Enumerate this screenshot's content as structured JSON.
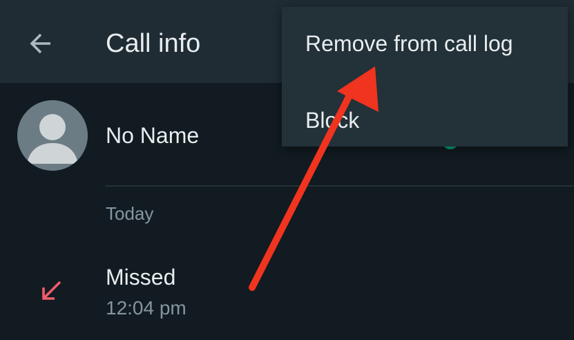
{
  "header": {
    "title": "Call info",
    "back_icon": "arrow-left-icon"
  },
  "contact": {
    "name": "No Name",
    "avatar_icon": "default-person-avatar-icon"
  },
  "call_log": {
    "date_label": "Today",
    "entries": [
      {
        "type": "Missed",
        "time": "12:04 pm",
        "icon": "missed-call-arrow-icon"
      }
    ]
  },
  "overflow_menu": {
    "items": [
      {
        "label": "Remove from call log"
      },
      {
        "label": "Block"
      }
    ]
  },
  "annotation": {
    "icon": "red-pointer-arrow-icon",
    "color": "#f0341f"
  },
  "colors": {
    "background": "#111b21",
    "toolbar": "#1f2c33",
    "menu": "#233138",
    "primary_text": "#e9edef",
    "secondary_text": "#8696a0",
    "missed_call": "#f15c6d",
    "accent_green": "#00a884"
  }
}
